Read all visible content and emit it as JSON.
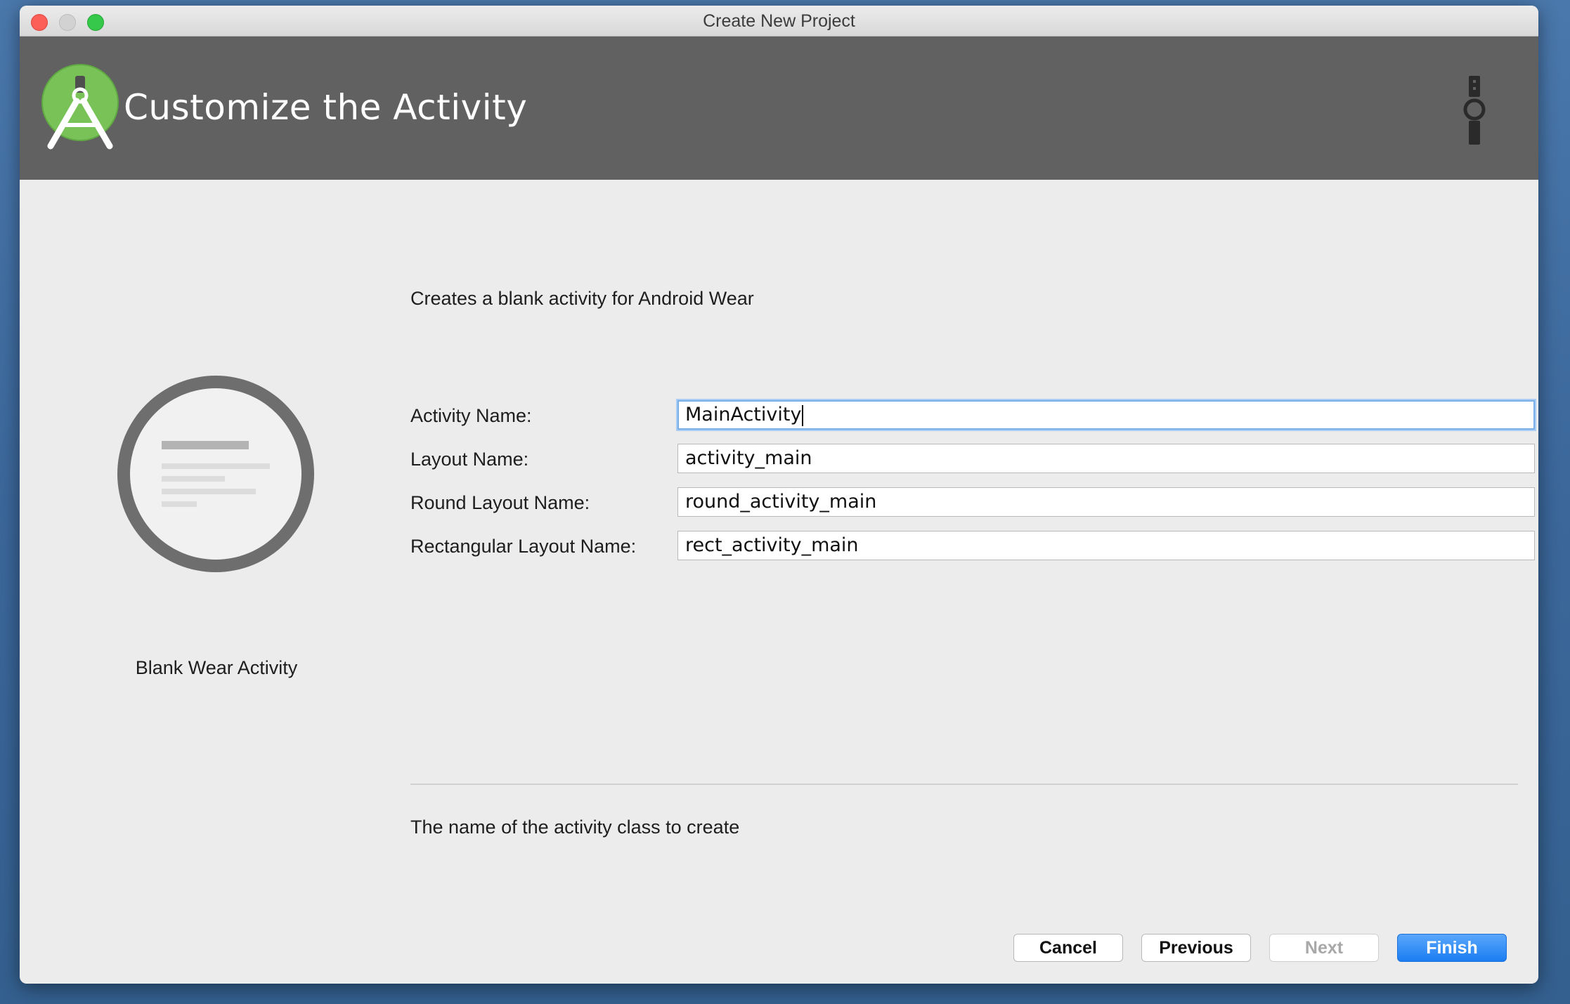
{
  "window": {
    "title": "Create New Project"
  },
  "header": {
    "title": "Customize the Activity",
    "logo_icon": "android-studio-icon",
    "device_icon": "wear-watch-icon",
    "background_color": "#616161"
  },
  "preview": {
    "label": "Blank Wear Activity",
    "icon": "blank-wear-activity-thumbnail"
  },
  "main": {
    "description": "Creates a blank activity for Android Wear",
    "fields": [
      {
        "label": "Activity Name:",
        "value": "MainActivity",
        "focused": true
      },
      {
        "label": "Layout Name:",
        "value": "activity_main",
        "focused": false
      },
      {
        "label": "Round Layout Name:",
        "value": "round_activity_main",
        "focused": false
      },
      {
        "label": "Rectangular Layout Name:",
        "value": "rect_activity_main",
        "focused": false
      }
    ],
    "help_text": "The name of the activity class to create"
  },
  "buttons": {
    "cancel": "Cancel",
    "previous": "Previous",
    "next": "Next",
    "finish": "Finish",
    "next_enabled": false,
    "accent_color": "#1b7df2"
  }
}
